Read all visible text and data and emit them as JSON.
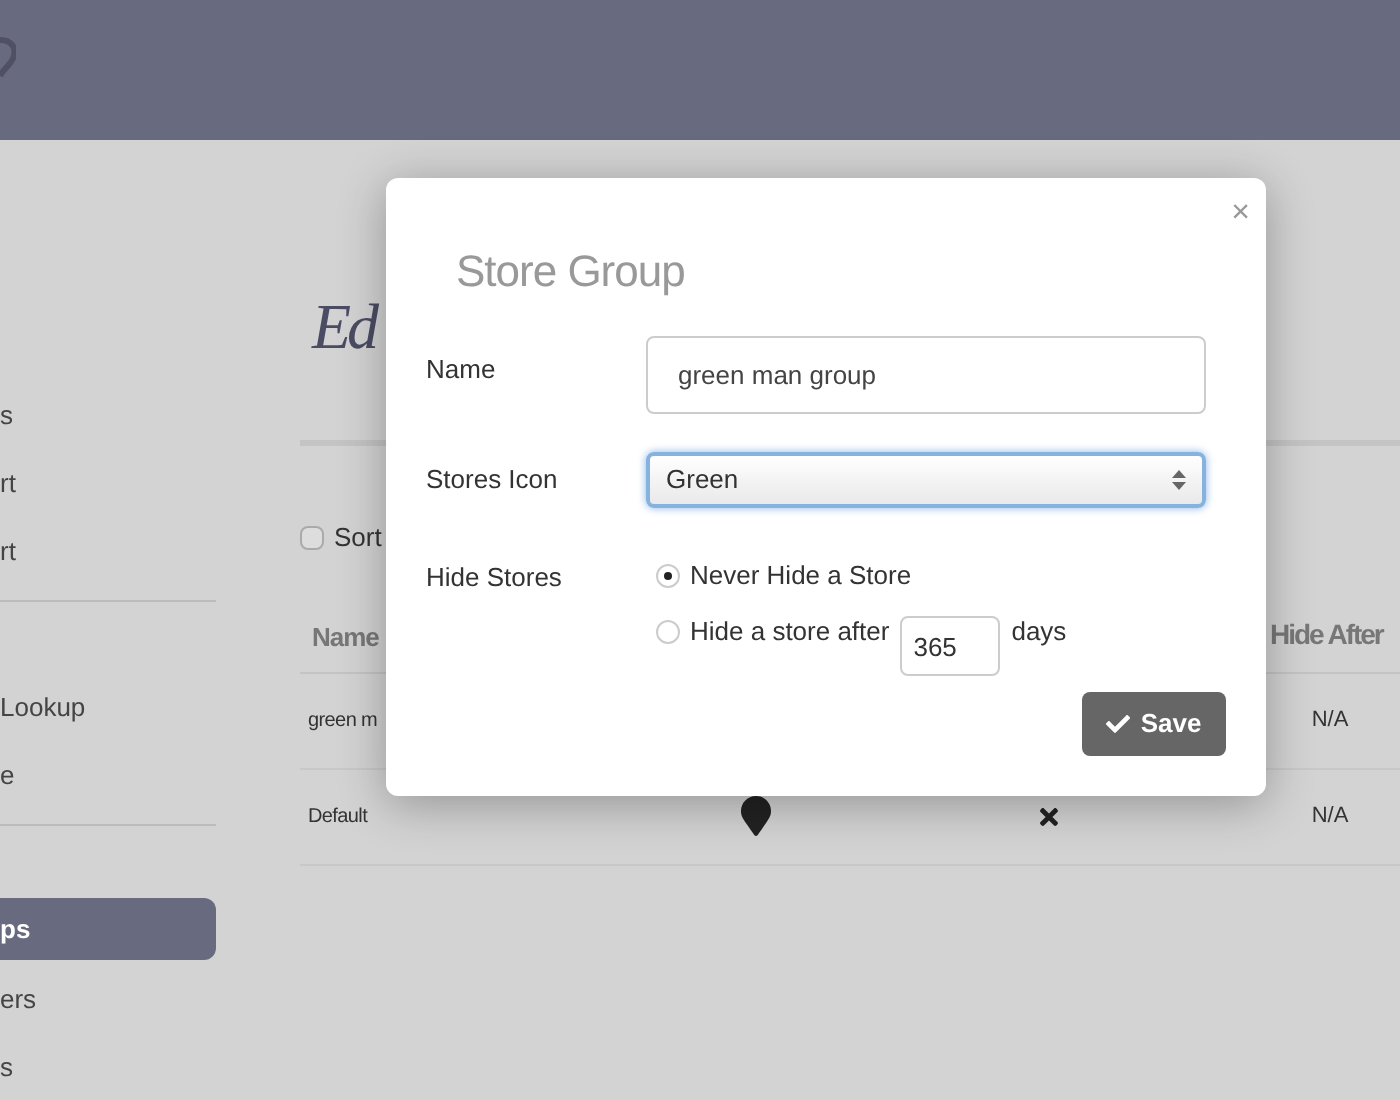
{
  "sidebar": {
    "groups": [
      [
        {
          "label": "s",
          "selected": false
        },
        {
          "label": "rt",
          "selected": false
        },
        {
          "label": "rt",
          "selected": false
        }
      ],
      [
        {
          "label": "Lookup",
          "selected": false
        },
        {
          "label": "e",
          "selected": false
        }
      ],
      [
        {
          "label": "ps",
          "selected": true
        },
        {
          "label": "ers",
          "selected": false
        },
        {
          "label": "s",
          "selected": false
        }
      ]
    ]
  },
  "page": {
    "title": "Ed",
    "sort": {
      "label": "Sort",
      "checked": false
    }
  },
  "table": {
    "columns": [
      "Name",
      "Hide After"
    ],
    "rows": [
      {
        "name": "green m",
        "hide_after": "N/A"
      },
      {
        "name": "Default",
        "hide_after": "N/A",
        "hidden": false
      }
    ]
  },
  "dialog": {
    "title": "Store Group",
    "close": "×",
    "name": {
      "label": "Name",
      "value": "green man group"
    },
    "icon": {
      "label": "Stores Icon",
      "value": "Green"
    },
    "hide": {
      "label": "Hide Stores",
      "options": [
        {
          "label": "Never Hide a Store",
          "selected": true,
          "kind": "plain"
        },
        {
          "label": "Hide a store after",
          "selected": false,
          "kind": "days",
          "value": "365",
          "suffix": "days"
        }
      ]
    },
    "save": "Save"
  }
}
